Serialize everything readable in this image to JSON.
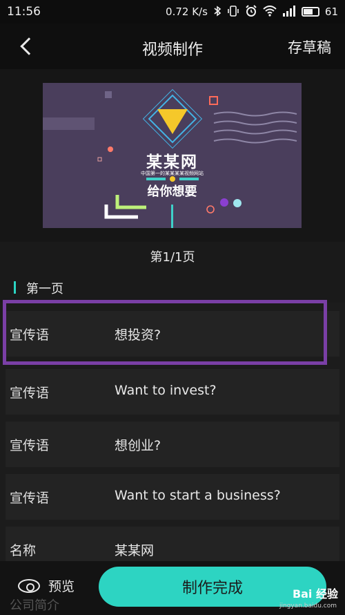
{
  "status_bar": {
    "time": "11:56",
    "net_speed": "0.72 K/s",
    "battery": "61",
    "icons": [
      "bluetooth-icon",
      "vibrate-icon",
      "alarm-icon",
      "wifi-icon",
      "signal-icon",
      "battery-icon"
    ]
  },
  "header": {
    "title": "视频制作",
    "right_action": "存草稿"
  },
  "preview_card": {
    "brand": "某某网",
    "subtitle": "中国第一的某某某某视频网站",
    "slogan": "给你想要"
  },
  "page_indicator": "第1/1页",
  "section": {
    "title": "第一页"
  },
  "fields": [
    {
      "label": "宣传语",
      "value": "想投资?"
    },
    {
      "label": "宣传语",
      "value": "Want to invest?"
    },
    {
      "label": "宣传语",
      "value": "想创业?"
    },
    {
      "label": "宣传语",
      "value": "Want to start a business?"
    },
    {
      "label": "名称",
      "value": "某某网"
    }
  ],
  "bottom": {
    "ghost_label": "公司简介",
    "preview_label": "预览",
    "finish_label": "制作完成",
    "watermark": "Bai 经验",
    "watermark_url": "jingyan.baidu.com"
  },
  "colors": {
    "accent": "#2dd4c2",
    "highlight": "#7a3fa6",
    "card_bg": "#4a3e5c"
  }
}
